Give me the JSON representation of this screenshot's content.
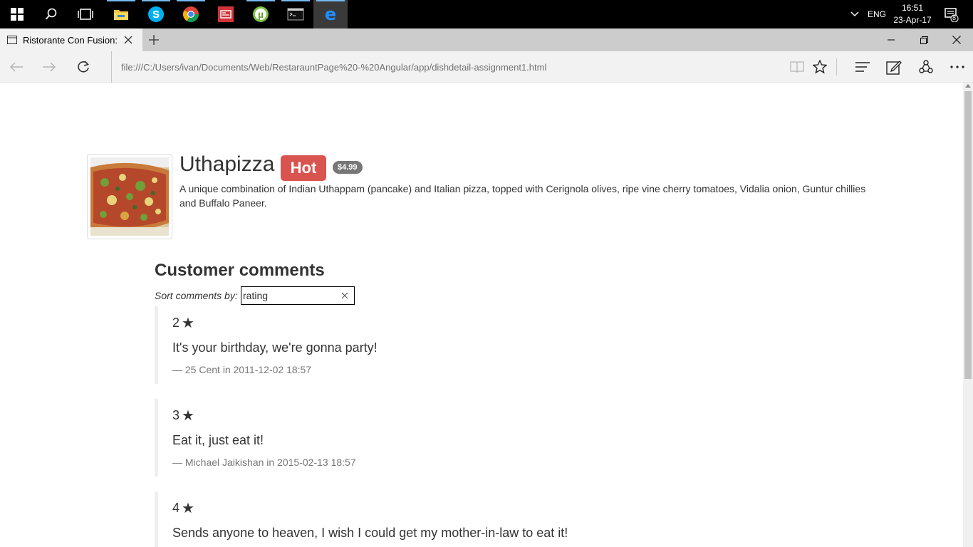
{
  "taskbar": {
    "apps": [
      {
        "name": "start",
        "icon": "windows-logo-icon"
      },
      {
        "name": "search",
        "icon": "search-icon"
      },
      {
        "name": "task-view",
        "icon": "task-view-icon"
      },
      {
        "name": "file-explorer",
        "icon": "folder-icon"
      },
      {
        "name": "skype",
        "icon": "skype-icon"
      },
      {
        "name": "chrome",
        "icon": "chrome-icon"
      },
      {
        "name": "news",
        "icon": "news-icon"
      },
      {
        "name": "utorrent",
        "icon": "utorrent-icon"
      },
      {
        "name": "terminal",
        "icon": "terminal-icon"
      },
      {
        "name": "edge",
        "icon": "edge-icon"
      }
    ],
    "language": "ENG",
    "time": "16:51",
    "date": "23-Apr-17",
    "notifications_count": "8"
  },
  "browser": {
    "tab_title": "Ristorante Con Fusion: I",
    "url": "file:///C:/Users/ivan/Documents/Web/RestarauntPage%20-%20Angular/app/dishdetail-assignment1.html"
  },
  "dish": {
    "name": "Uthapizza",
    "label": "Hot",
    "price": "$4.99",
    "description": "A unique combination of Indian Uthappam (pancake) and Italian pizza, topped with Cerignola olives, ripe vine cherry tomatoes, Vidalia onion, Guntur chillies and Buffalo Paneer."
  },
  "comments_section": {
    "title": "Customer comments",
    "sort_label": "Sort comments by:",
    "sort_value": "rating"
  },
  "comments": [
    {
      "rating": "2",
      "text": "It's your birthday, we're gonna party!",
      "byline": "— 25 Cent in 2011-12-02 18:57"
    },
    {
      "rating": "3",
      "text": "Eat it, just eat it!",
      "byline": "— Michael Jaikishan in 2015-02-13 18:57"
    },
    {
      "rating": "4",
      "text": "Sends anyone to heaven, I wish I could get my mother-in-law to eat it!",
      "byline": ""
    }
  ]
}
